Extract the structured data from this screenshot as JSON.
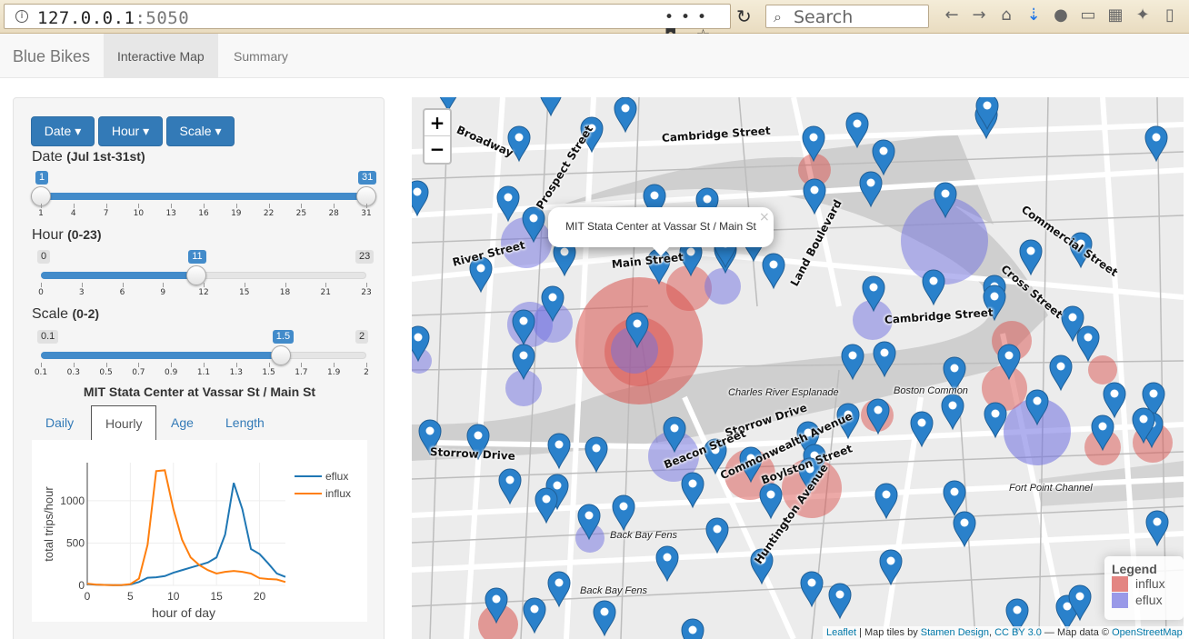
{
  "browser": {
    "url_host": "127.0.0.1",
    "url_port": ":5050",
    "search_placeholder": "Search",
    "url_actions": "••• ◘ ☆"
  },
  "navbar": {
    "brand": "Blue Bikes",
    "tabs": [
      {
        "label": "Interactive Map",
        "active": true
      },
      {
        "label": "Summary",
        "active": false
      }
    ]
  },
  "sidebar": {
    "dropdowns": [
      {
        "label": "Date ▾"
      },
      {
        "label": "Hour ▾"
      },
      {
        "label": "Scale ▾"
      }
    ],
    "date_slider": {
      "label": "Date",
      "range_label": "(Jul 1st-31st)",
      "min": 1,
      "max": 31,
      "low": 1,
      "high": 31,
      "min_label": "1",
      "max_label": "31",
      "ticks": [
        "1",
        "4",
        "7",
        "10",
        "13",
        "16",
        "19",
        "22",
        "25",
        "28",
        "31"
      ]
    },
    "hour_slider": {
      "label": "Hour",
      "range_label": "(0-23)",
      "min": 0,
      "max": 23,
      "value": 11,
      "min_label": "0",
      "max_label": "23",
      "value_label": "11",
      "ticks": [
        "0",
        "3",
        "6",
        "9",
        "12",
        "15",
        "18",
        "21",
        "23"
      ]
    },
    "scale_slider": {
      "label": "Scale",
      "range_label": "(0-2)",
      "min": 0.1,
      "max": 2,
      "value": 1.5,
      "min_label": "0.1",
      "max_label": "2",
      "value_label": "1.5",
      "ticks": [
        "0.1",
        "0.3",
        "0.5",
        "0.7",
        "0.9",
        "1.1",
        "1.3",
        "1.5",
        "1.7",
        "1.9",
        "2"
      ]
    },
    "station_title": "MIT Stata Center at Vassar St / Main St",
    "subtabs": [
      {
        "label": "Daily",
        "active": false
      },
      {
        "label": "Hourly",
        "active": true
      },
      {
        "label": "Age",
        "active": false
      },
      {
        "label": "Length",
        "active": false
      }
    ]
  },
  "chart_data": {
    "type": "line",
    "title": "",
    "xlabel": "hour of day",
    "ylabel": "total trips/hour",
    "xlim": [
      0,
      23
    ],
    "ylim": [
      0,
      1450
    ],
    "xticks": [
      "0",
      "5",
      "10",
      "15",
      "20"
    ],
    "yticks": [
      "0",
      "500",
      "1000"
    ],
    "legend_position": "top-right",
    "x": [
      0,
      1,
      2,
      3,
      4,
      5,
      6,
      7,
      8,
      9,
      10,
      11,
      12,
      13,
      14,
      15,
      16,
      17,
      18,
      19,
      20,
      21,
      22,
      23
    ],
    "series": [
      {
        "name": "eflux",
        "color": "#1f77b4",
        "values": [
          15,
          8,
          5,
          3,
          3,
          10,
          40,
          90,
          95,
          110,
          150,
          180,
          210,
          240,
          270,
          330,
          600,
          1210,
          900,
          430,
          370,
          260,
          140,
          100
        ]
      },
      {
        "name": "influx",
        "color": "#ff7f0e",
        "values": [
          20,
          10,
          5,
          3,
          4,
          15,
          80,
          480,
          1350,
          1360,
          900,
          540,
          330,
          240,
          180,
          140,
          160,
          170,
          160,
          140,
          85,
          75,
          70,
          40
        ]
      }
    ]
  },
  "map": {
    "popup_text": "MIT Stata Center at Vassar St / Main St",
    "popup_close": "×",
    "zoom_in": "+",
    "zoom_out": "−",
    "legend": {
      "title": "Legend",
      "items": [
        {
          "label": "influx",
          "color": "#d9534f"
        },
        {
          "label": "eflux",
          "color": "#6f6fe0"
        }
      ]
    },
    "attribution": {
      "leaflet": "Leaflet",
      "sep1": " | Map tiles by ",
      "stamen": "Stamen Design",
      "sep2": ", ",
      "license": "CC BY 3.0",
      "sep3": " — Map data © ",
      "osm": "OpenStreetMap"
    },
    "place_labels": [
      "Charles River Esplanade",
      "Boston Common",
      "Back Bay Fens",
      "Fort Point Channel"
    ],
    "street_labels": [
      "Cambridge Street",
      "Main Street",
      "Broadway",
      "Prospect Street",
      "Land Boulevard",
      "Storrow Drive",
      "Commonwealth Avenue",
      "Huntington Avenue",
      "Boylston Street",
      "Beacon Street",
      "Cross Street",
      "Commercial Street",
      "River Street"
    ]
  }
}
